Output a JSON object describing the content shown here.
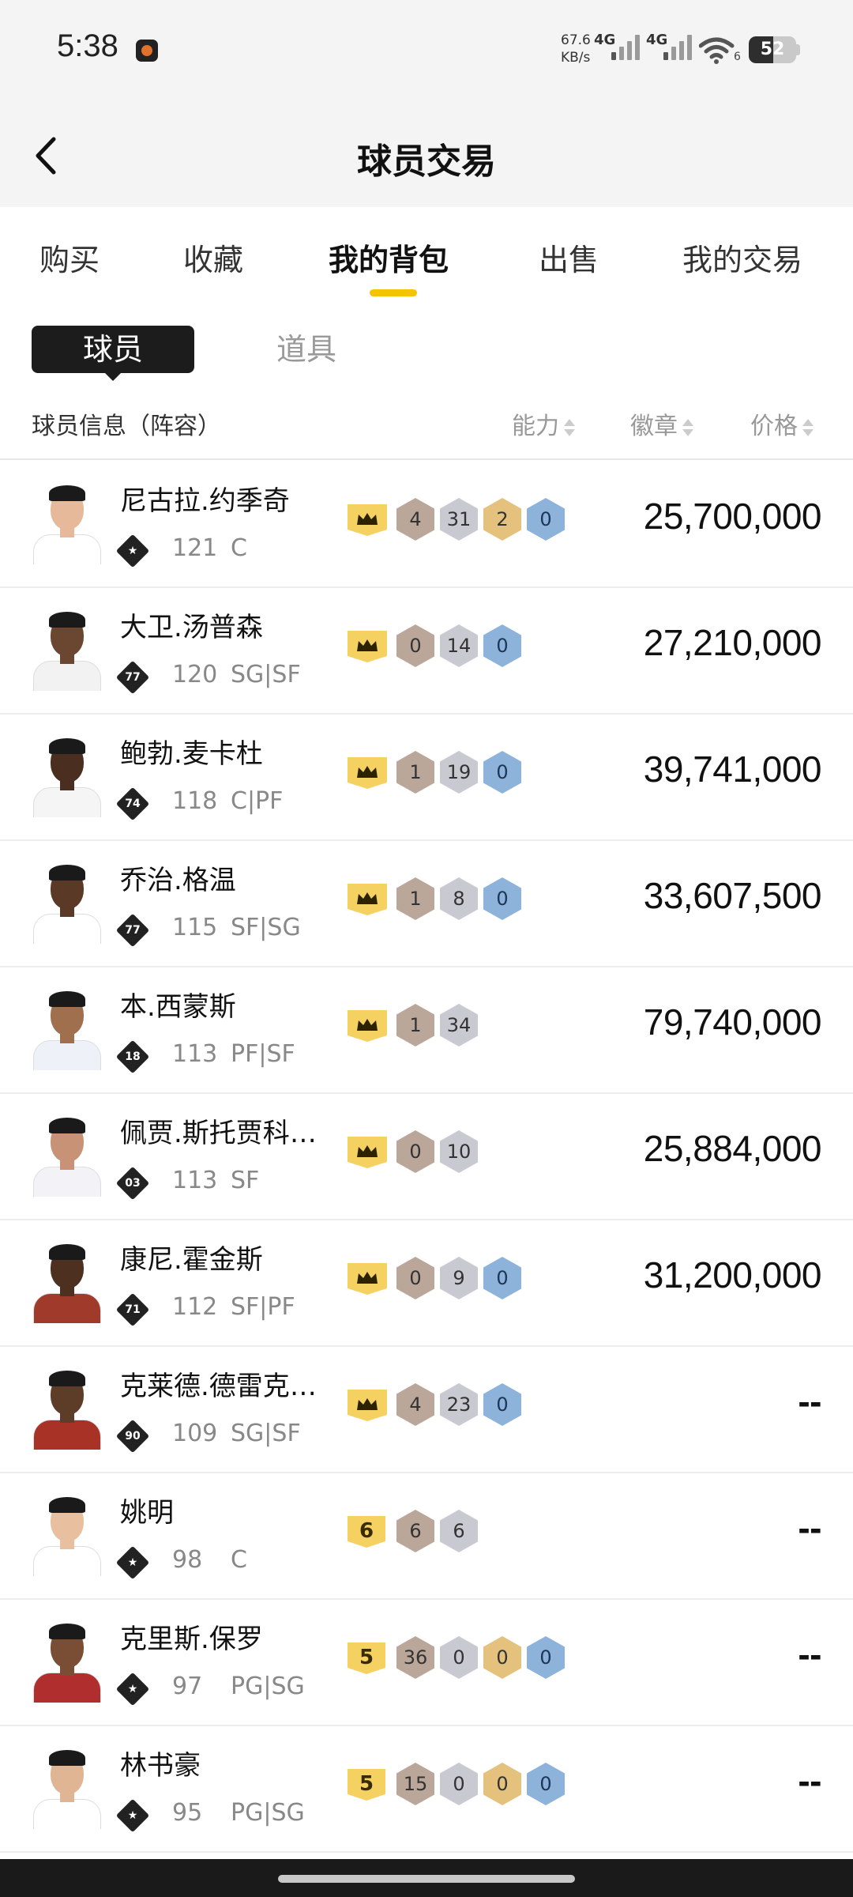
{
  "status_bar": {
    "time": "5:38",
    "net_speed_value": "67.6",
    "net_speed_unit": "KB/s",
    "network_1": "4G",
    "network_2": "4G",
    "wifi_label": "6",
    "battery": "52",
    "battery_level": 0.52
  },
  "header": {
    "title": "球员交易",
    "back_icon": "chevron-left-icon"
  },
  "main_tabs": [
    {
      "label": "购买",
      "active": false
    },
    {
      "label": "收藏",
      "active": false
    },
    {
      "label": "我的背包",
      "active": true
    },
    {
      "label": "出售",
      "active": false
    },
    {
      "label": "我的交易",
      "active": false
    }
  ],
  "sub_tabs": [
    {
      "label": "球员",
      "active": true
    },
    {
      "label": "道具",
      "active": false
    }
  ],
  "columns": {
    "info": "球员信息（阵容）",
    "ability": "能力",
    "badges": "徽章",
    "price": "价格"
  },
  "players": [
    {
      "name": "尼古拉.约季奇",
      "rank": "",
      "rating": "121",
      "position": "C",
      "level": "crown",
      "badges": [
        {
          "v": "4",
          "t": "bronze"
        },
        {
          "v": "31",
          "t": "silver"
        },
        {
          "v": "2",
          "t": "gold"
        },
        {
          "v": "0",
          "t": "blue"
        }
      ],
      "price": "25,700,000"
    },
    {
      "name": "大卫.汤普森",
      "rank": "77",
      "rating": "120",
      "position": "SG|SF",
      "level": "crown",
      "badges": [
        {
          "v": "0",
          "t": "bronze"
        },
        {
          "v": "14",
          "t": "silver"
        },
        {
          "v": "0",
          "t": "blue"
        }
      ],
      "price": "27,210,000"
    },
    {
      "name": "鲍勃.麦卡杜",
      "rank": "74",
      "rating": "118",
      "position": "C|PF",
      "level": "crown",
      "badges": [
        {
          "v": "1",
          "t": "bronze"
        },
        {
          "v": "19",
          "t": "silver"
        },
        {
          "v": "0",
          "t": "blue"
        }
      ],
      "price": "39,741,000"
    },
    {
      "name": "乔治.格温",
      "rank": "77",
      "rating": "115",
      "position": "SF|SG",
      "level": "crown",
      "badges": [
        {
          "v": "1",
          "t": "bronze"
        },
        {
          "v": "8",
          "t": "silver"
        },
        {
          "v": "0",
          "t": "blue"
        }
      ],
      "price": "33,607,500"
    },
    {
      "name": "本.西蒙斯",
      "rank": "18",
      "rating": "113",
      "position": "PF|SF",
      "level": "crown",
      "badges": [
        {
          "v": "1",
          "t": "bronze"
        },
        {
          "v": "34",
          "t": "silver"
        }
      ],
      "price": "79,740,000"
    },
    {
      "name": "佩贾.斯托贾科维奇",
      "rank": "03",
      "rating": "113",
      "position": "SF",
      "level": "crown",
      "badges": [
        {
          "v": "0",
          "t": "bronze"
        },
        {
          "v": "10",
          "t": "silver"
        }
      ],
      "price": "25,884,000"
    },
    {
      "name": "康尼.霍金斯",
      "rank": "71",
      "rating": "112",
      "position": "SF|PF",
      "level": "crown",
      "badges": [
        {
          "v": "0",
          "t": "bronze"
        },
        {
          "v": "9",
          "t": "silver"
        },
        {
          "v": "0",
          "t": "blue"
        }
      ],
      "price": "31,200,000"
    },
    {
      "name": "克莱德.德雷克斯勒",
      "rank": "90",
      "rating": "109",
      "position": "SG|SF",
      "level": "crown",
      "badges": [
        {
          "v": "4",
          "t": "bronze"
        },
        {
          "v": "23",
          "t": "silver"
        },
        {
          "v": "0",
          "t": "blue"
        }
      ],
      "price": "--"
    },
    {
      "name": "姚明",
      "rank": "",
      "rating": "98",
      "position": "C",
      "level": "6",
      "badges": [
        {
          "v": "6",
          "t": "bronze"
        },
        {
          "v": "6",
          "t": "silver"
        }
      ],
      "price": "--"
    },
    {
      "name": "克里斯.保罗",
      "rank": "",
      "rating": "97",
      "position": "PG|SG",
      "level": "5",
      "badges": [
        {
          "v": "36",
          "t": "bronze"
        },
        {
          "v": "0",
          "t": "silver"
        },
        {
          "v": "0",
          "t": "gold"
        },
        {
          "v": "0",
          "t": "blue"
        }
      ],
      "price": "--"
    },
    {
      "name": "林书豪",
      "rank": "",
      "rating": "95",
      "position": "PG|SG",
      "level": "5",
      "badges": [
        {
          "v": "15",
          "t": "bronze"
        },
        {
          "v": "0",
          "t": "silver"
        },
        {
          "v": "0",
          "t": "gold"
        },
        {
          "v": "0",
          "t": "blue"
        }
      ],
      "price": "--"
    }
  ],
  "colors": {
    "accent_yellow": "#f5c400",
    "badge_bronze": "#bba79a",
    "badge_silver": "#c9cad1",
    "badge_gold": "#e4c27e",
    "badge_blue": "#8eb3da"
  }
}
